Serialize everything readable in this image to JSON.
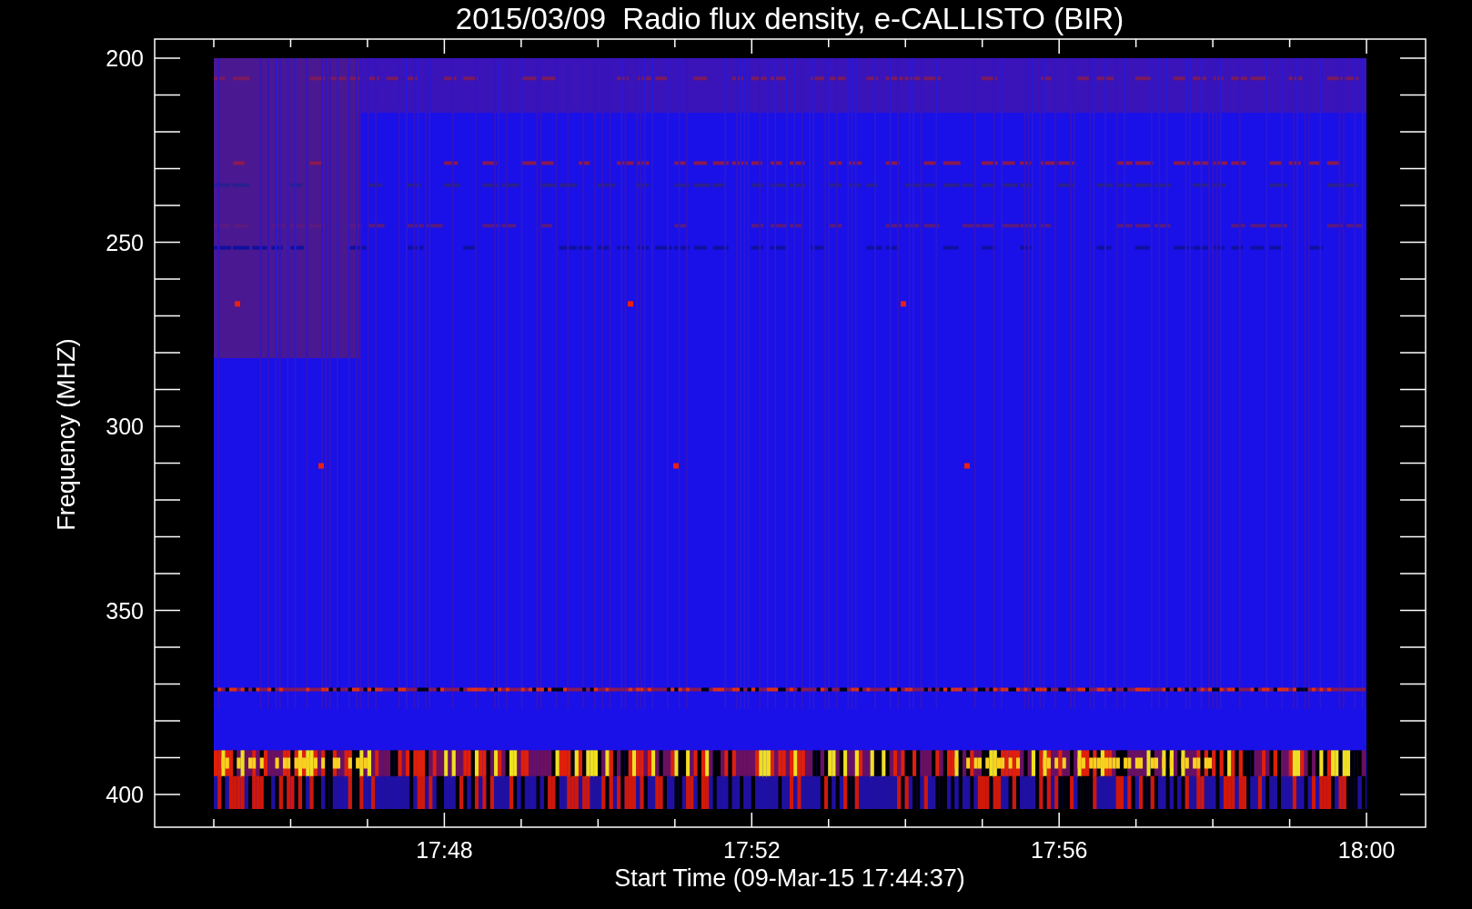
{
  "title": "2015/03/09  Radio flux density, e-CALLISTO (BIR)",
  "y_axis": {
    "label": "Frequency (MHZ)",
    "ticks": [
      "200",
      "250",
      "300",
      "350",
      "400"
    ]
  },
  "x_axis": {
    "label": "Start Time (09-Mar-15 17:44:37)",
    "ticks": [
      "17:48",
      "17:52",
      "17:56",
      "18:00"
    ]
  }
}
